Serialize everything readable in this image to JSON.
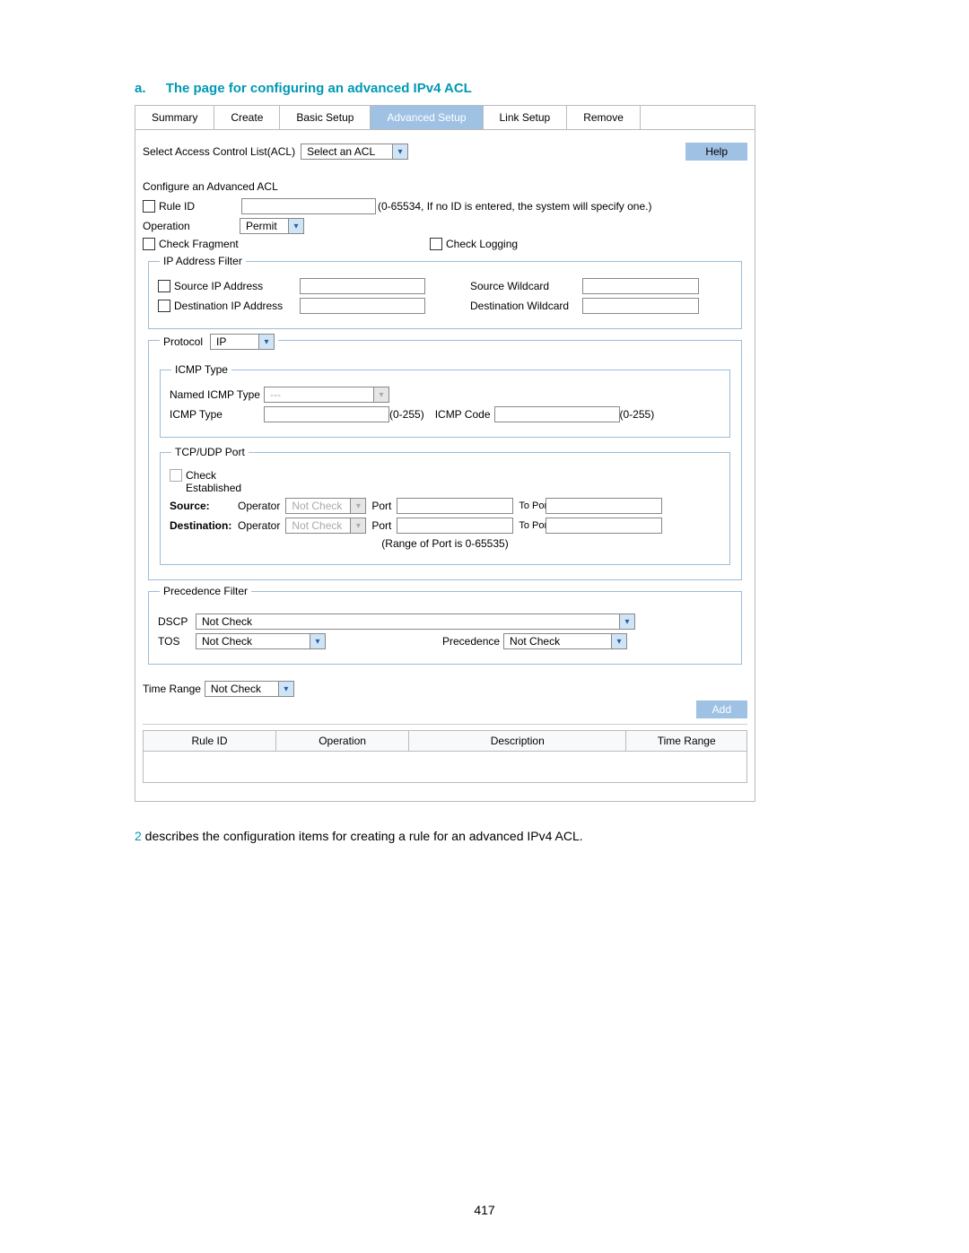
{
  "heading_prefix": "a.",
  "heading_text": "The page for configuring an advanced IPv4 ACL",
  "tabs": {
    "summary": "Summary",
    "create": "Create",
    "basic": "Basic Setup",
    "advanced": "Advanced Setup",
    "link": "Link Setup",
    "remove": "Remove"
  },
  "select_acl_label": "Select Access Control List(ACL)",
  "select_acl_value": "Select an ACL",
  "help": "Help",
  "configure_title": "Configure an Advanced ACL",
  "rule_id_label": "Rule ID",
  "rule_id_hint": "(0-65534, If no ID is entered, the system will specify one.)",
  "operation_label": "Operation",
  "operation_value": "Permit",
  "check_fragment": "Check Fragment",
  "check_logging": "Check Logging",
  "ip_filter": {
    "legend": "IP Address Filter",
    "source_ip": "Source IP Address",
    "source_wc": "Source Wildcard",
    "dest_ip": "Destination IP Address",
    "dest_wc": "Destination Wildcard"
  },
  "protocol": {
    "legend": "Protocol",
    "value": "IP"
  },
  "icmp": {
    "legend": "ICMP Type",
    "named_label": "Named ICMP Type",
    "named_value": "---",
    "type_label": "ICMP Type",
    "type_hint": "(0-255)",
    "code_label": "ICMP Code",
    "code_hint": "(0-255)"
  },
  "tcpudp": {
    "legend": "TCP/UDP Port",
    "check_est": "Check Established",
    "source": "Source:",
    "dest": "Destination:",
    "operator": "Operator",
    "op_value": "Not Check",
    "port": "Port",
    "to_port": "To Port",
    "range_hint": "(Range of Port is 0-65535)"
  },
  "prec": {
    "legend": "Precedence Filter",
    "dscp": "DSCP",
    "dscp_value": "Not Check",
    "tos": "TOS",
    "tos_value": "Not Check",
    "prec_label": "Precedence",
    "prec_value": "Not Check"
  },
  "time_range_label": "Time Range",
  "time_range_value": "Not Check",
  "add_btn": "Add",
  "table": {
    "rule_id": "Rule ID",
    "operation": "Operation",
    "description": "Description",
    "time_range": "Time Range"
  },
  "footnote_num": "2",
  "footnote_text": " describes the configuration items for creating a rule for an advanced IPv4 ACL.",
  "page_number": "417"
}
